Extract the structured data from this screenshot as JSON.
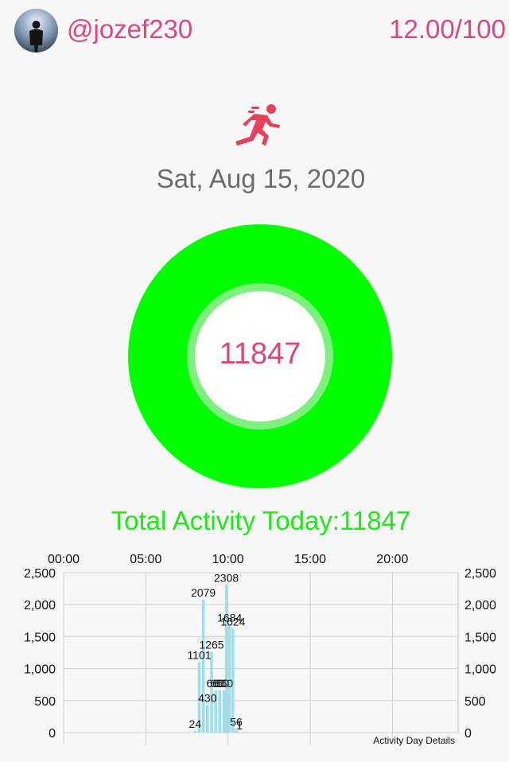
{
  "header": {
    "username": "@jozef230",
    "score": "12.00/100",
    "avatar_icon": "user-avatar"
  },
  "activity_icon": "running-person-icon",
  "date": "Sat, Aug 15, 2020",
  "ring": {
    "value": "11847",
    "color": "#00ff00"
  },
  "total_label": "Total Activity Today:11847",
  "colors": {
    "accent": "#e0447e",
    "ring": "#00ff00",
    "total_text": "#1ee81a",
    "bars": "#9be0ec"
  },
  "chart_data": {
    "type": "bar",
    "title": "",
    "description": "Activity Day Details",
    "x_axis_position": "top",
    "x_range_hours": [
      0,
      24
    ],
    "x_tick_labels": [
      "00:00",
      "05:00",
      "10:00",
      "15:00",
      "20:00"
    ],
    "ylim": [
      0,
      2500
    ],
    "y_tick_labels": [
      "0",
      "500",
      "1,000",
      "1,500",
      "2,000",
      "2,500"
    ],
    "y_axes": [
      "left",
      "right"
    ],
    "grid": true,
    "bars": [
      {
        "hour": 8.0,
        "value": 24
      },
      {
        "hour": 8.25,
        "value": 1101
      },
      {
        "hour": 8.5,
        "value": 2079
      },
      {
        "hour": 8.75,
        "value": 430
      },
      {
        "hour": 9.0,
        "value": 1265
      },
      {
        "hour": 9.25,
        "value": 660
      },
      {
        "hour": 9.5,
        "value": 660
      },
      {
        "hour": 9.75,
        "value": 660
      },
      {
        "hour": 9.9,
        "value": 2308
      },
      {
        "hour": 10.1,
        "value": 1684
      },
      {
        "hour": 10.3,
        "value": 1624
      },
      {
        "hour": 10.5,
        "value": 56
      },
      {
        "hour": 10.7,
        "value": 1
      }
    ]
  }
}
